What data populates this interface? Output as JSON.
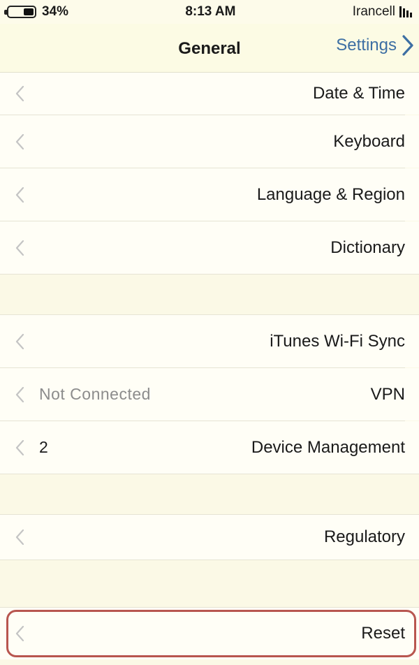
{
  "status_bar": {
    "battery": "34%",
    "time": "8:13 AM",
    "carrier": "Irancell"
  },
  "nav": {
    "title": "General",
    "back_label": "Settings"
  },
  "rows": [
    {
      "label": "Date & Time",
      "detail": ""
    },
    {
      "label": "Keyboard",
      "detail": ""
    },
    {
      "label": "Language & Region",
      "detail": ""
    },
    {
      "label": "Dictionary",
      "detail": ""
    },
    {
      "label": "iTunes Wi-Fi Sync",
      "detail": ""
    },
    {
      "label": "VPN",
      "detail": "Not Connected"
    },
    {
      "label": "Device Management",
      "detail": "2"
    },
    {
      "label": "Regulatory",
      "detail": ""
    },
    {
      "label": "Reset",
      "detail": ""
    }
  ],
  "colors": {
    "background": "#fbf9e6",
    "cell": "#fffef6",
    "tint": "#3d6fa3",
    "highlight": "#b8564f"
  },
  "icons": {
    "back": "chevron-back-icon",
    "disclosure": "chevron-disclosure-icon",
    "battery": "battery-icon",
    "signal": "signal-bars-icon"
  }
}
